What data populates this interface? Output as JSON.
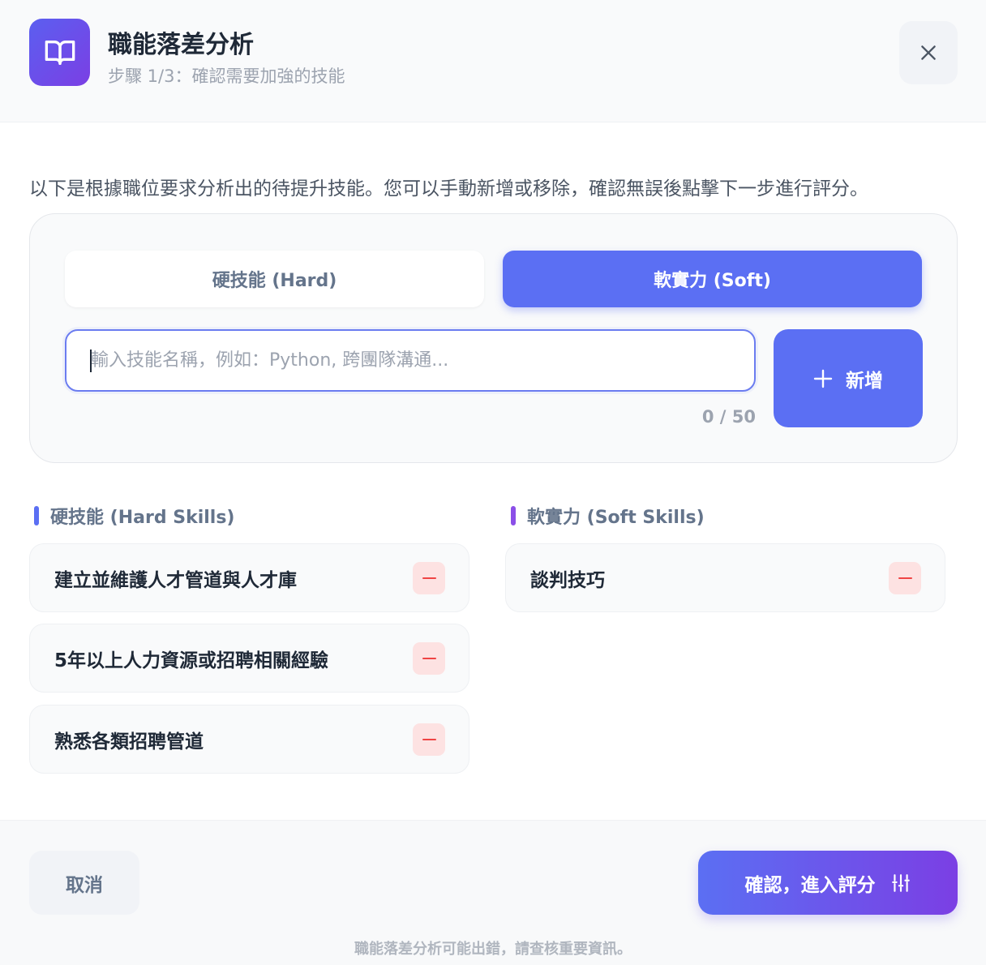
{
  "header": {
    "title": "職能落差分析",
    "subtitle": "步驟 1/3：確認需要加強的技能",
    "app_icon": "book-open-icon",
    "close_icon": "close-icon"
  },
  "description": "以下是根據職位要求分析出的待提升技能。您可以手動新增或移除，確認無誤後點擊下一步進行評分。",
  "tabs": [
    {
      "label": "硬技能 (Hard)",
      "active": false
    },
    {
      "label": "軟實力 (Soft)",
      "active": true
    }
  ],
  "input": {
    "value": "",
    "placeholder": "輸入技能名稱，例如：Python, 跨團隊溝通...",
    "char_count": "0 / 50"
  },
  "add_button": {
    "label": "新增",
    "icon": "plus-icon"
  },
  "hard_skills": {
    "heading": "硬技能 (Hard Skills)",
    "accent": "#5b6ff3",
    "items": [
      {
        "label": "建立並維護人才管道與人才庫"
      },
      {
        "label": "5年以上人力資源或招聘相關經驗"
      },
      {
        "label": "熟悉各類招聘管道"
      }
    ]
  },
  "soft_skills": {
    "heading": "軟實力 (Soft Skills)",
    "accent": "#8b4fe8",
    "items": [
      {
        "label": "談判技巧"
      }
    ]
  },
  "footer": {
    "cancel_label": "取消",
    "confirm_label": "確認，進入評分",
    "confirm_icon": "sliders-icon",
    "disclaimer": "職能落差分析可能出錯，請查核重要資訊。"
  },
  "colors": {
    "primary": "#5b6ff3",
    "gradient_end": "#7b3fe4",
    "danger": "#ef4444",
    "danger_bg": "#fde2e2"
  }
}
